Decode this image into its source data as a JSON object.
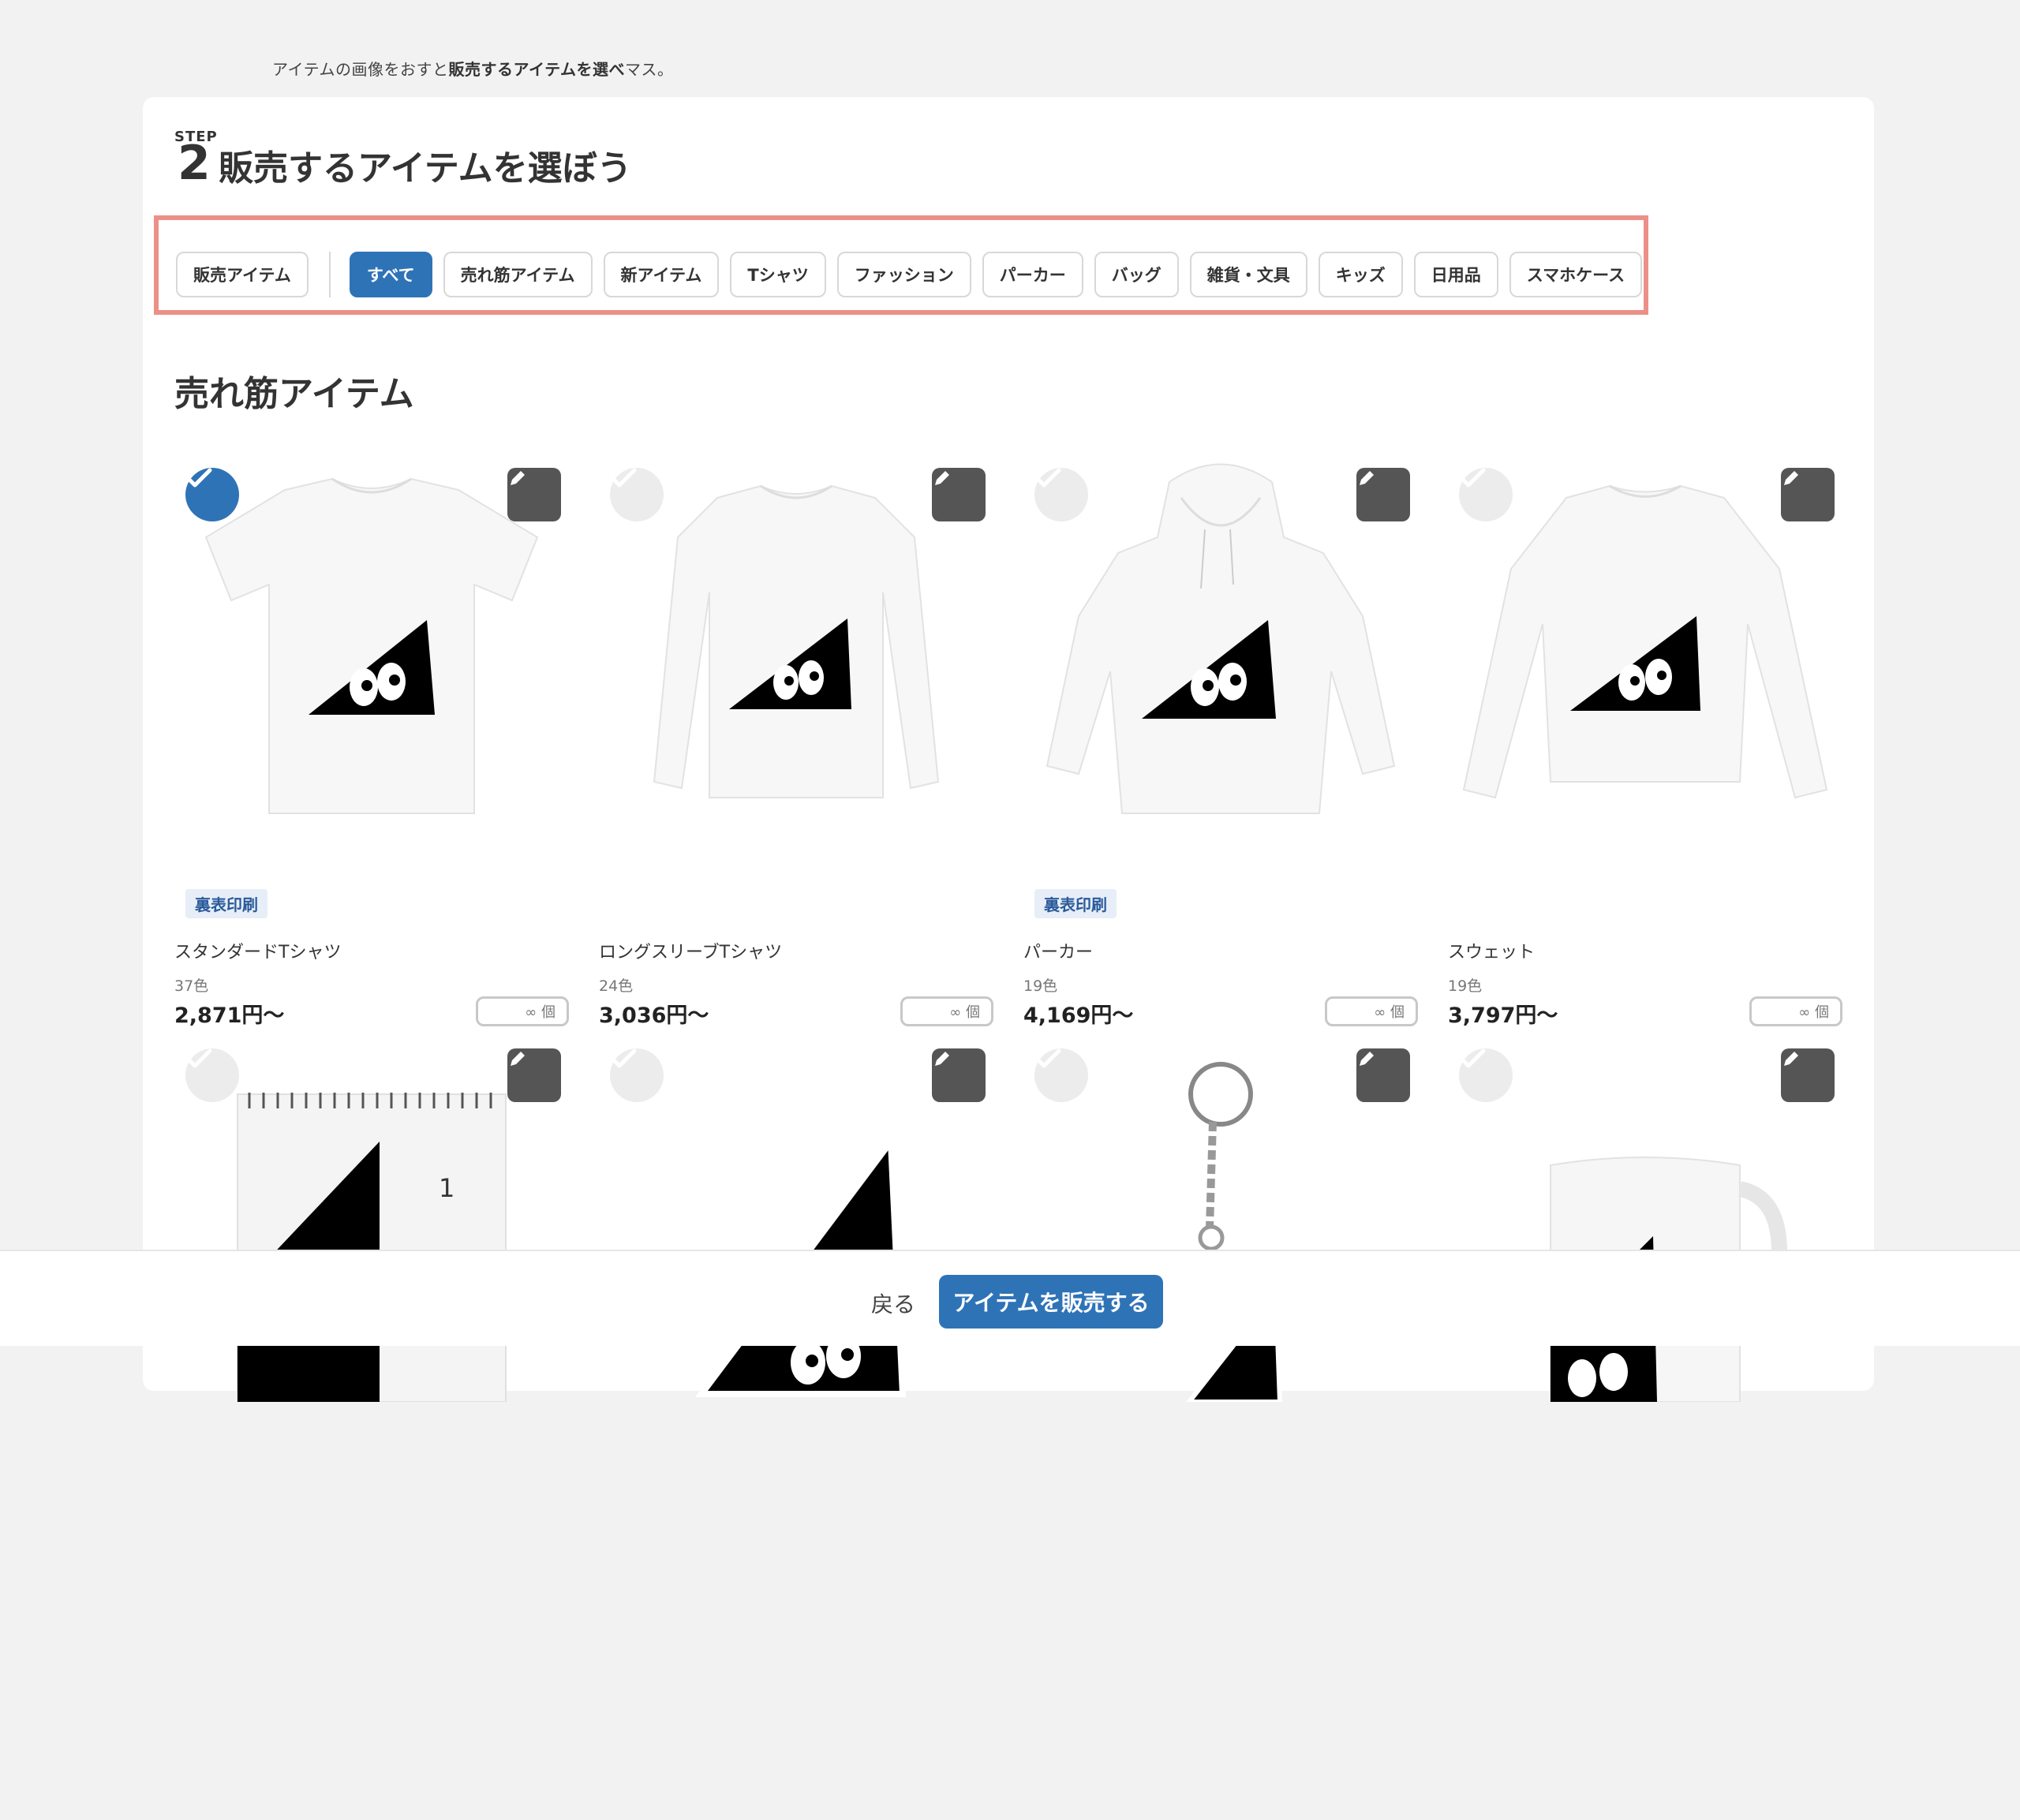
{
  "hint": {
    "prefix": "アイテムの画像をおすと",
    "bold": "販売するアイテムを選べ",
    "suffix": "マス。"
  },
  "step": {
    "label": "STEP",
    "number": "2",
    "title": "販売するアイテムを選ぼう"
  },
  "filters": {
    "selling": "販売アイテム",
    "categories": [
      "すべて",
      "売れ筋アイテム",
      "新アイテム",
      "Tシャツ",
      "ファッション",
      "パーカー",
      "バッグ",
      "雑貨・文具",
      "キッズ",
      "日用品",
      "スマホケース"
    ],
    "active_index": 0
  },
  "section_title": "売れ筋アイテム",
  "items": [
    {
      "name": "スタンダードTシャツ",
      "colors": "37色",
      "price": "2,871円〜",
      "qty": "∞ 個",
      "badge": "裏表印刷",
      "selected": true
    },
    {
      "name": "ロングスリーブTシャツ",
      "colors": "24色",
      "price": "3,036円〜",
      "qty": "∞ 個",
      "badge": "",
      "selected": false
    },
    {
      "name": "パーカー",
      "colors": "19色",
      "price": "4,169円〜",
      "qty": "∞ 個",
      "badge": "裏表印刷",
      "selected": false
    },
    {
      "name": "スウェット",
      "colors": "19色",
      "price": "3,797円〜",
      "qty": "∞ 個",
      "badge": "",
      "selected": false
    }
  ],
  "calendar_number": "1",
  "footer": {
    "back": "戻る",
    "sell": "アイテムを販売する"
  },
  "colors": {
    "accent": "#2f73b7",
    "highlight_border": "#ec9087"
  },
  "icons": {
    "check": "check-icon",
    "edit": "pencil-icon"
  }
}
